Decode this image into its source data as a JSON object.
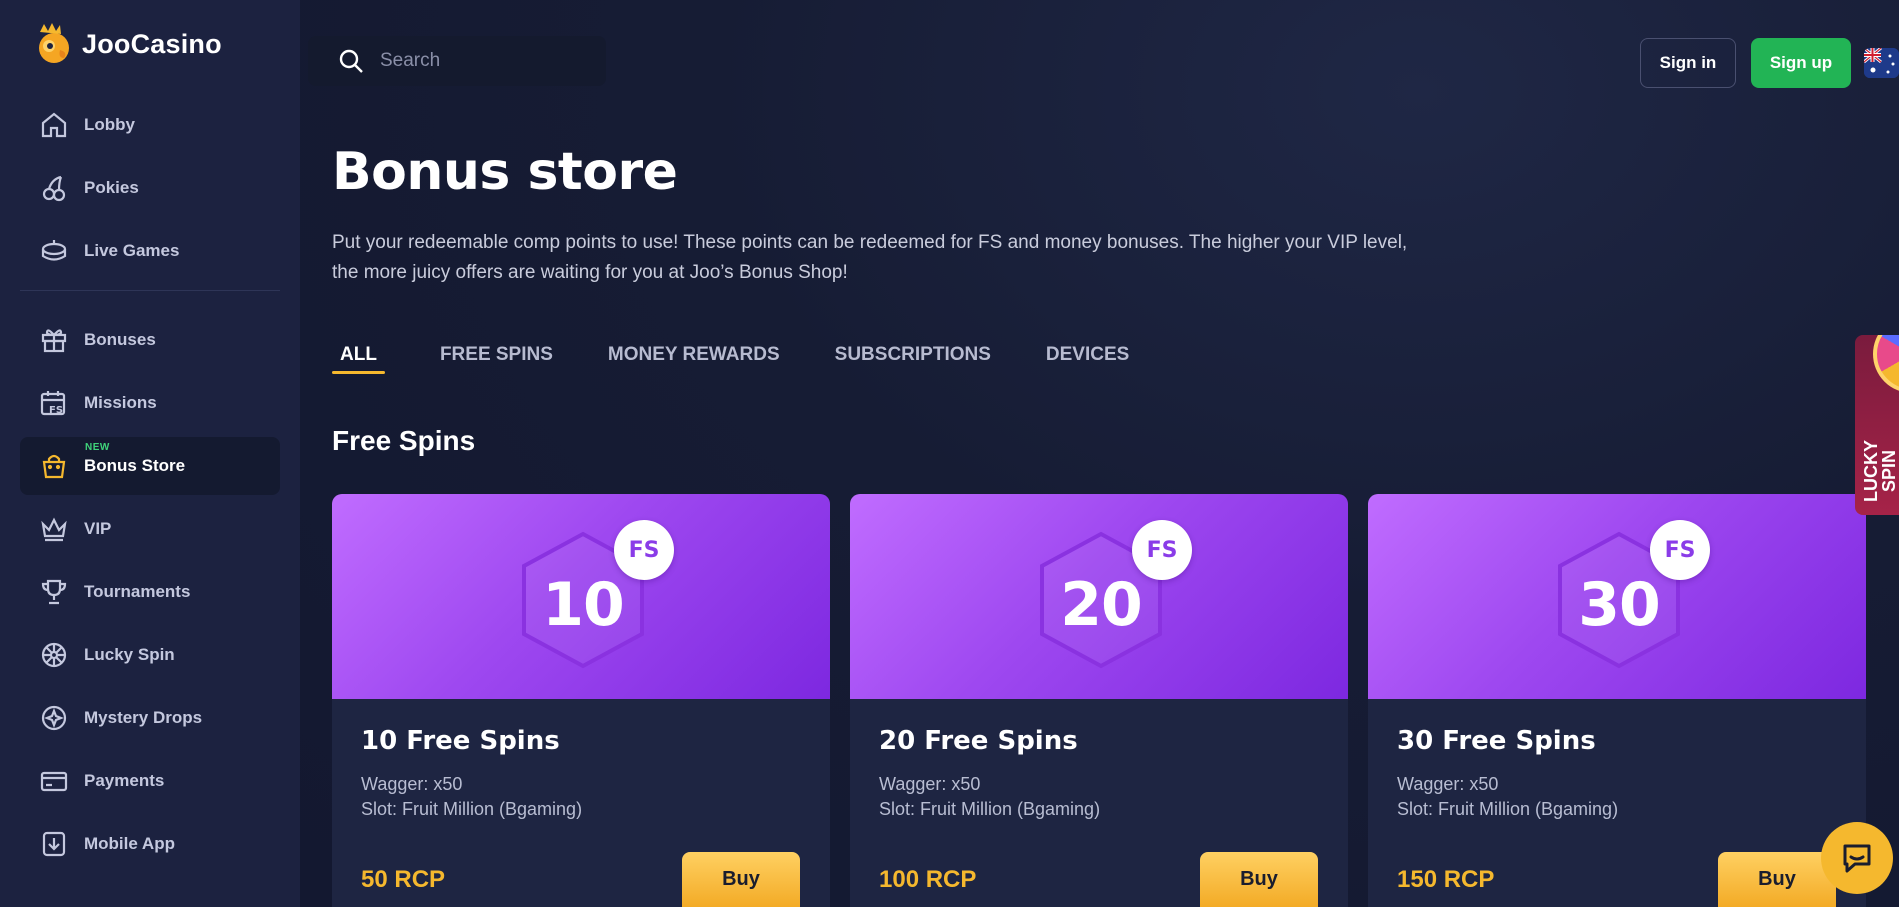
{
  "brand": {
    "name": "JooCasino"
  },
  "sidebar": {
    "items": [
      {
        "label": "Lobby",
        "icon": "home-icon"
      },
      {
        "label": "Pokies",
        "icon": "cherries-icon"
      },
      {
        "label": "Live Games",
        "icon": "live-table-icon"
      }
    ],
    "items2": [
      {
        "label": "Bonuses",
        "icon": "gift-icon"
      },
      {
        "label": "Missions",
        "icon": "calendar-fs-icon"
      },
      {
        "label": "Bonus Store",
        "icon": "shopping-bag-icon",
        "badge": "NEW",
        "active": true
      },
      {
        "label": "VIP",
        "icon": "crown-icon"
      },
      {
        "label": "Tournaments",
        "icon": "trophy-icon"
      },
      {
        "label": "Lucky Spin",
        "icon": "wheel-icon"
      },
      {
        "label": "Mystery Drops",
        "icon": "mystery-drop-icon"
      },
      {
        "label": "Payments",
        "icon": "card-icon"
      },
      {
        "label": "Mobile App",
        "icon": "download-icon"
      }
    ]
  },
  "header": {
    "search_placeholder": "Search",
    "signin_label": "Sign in",
    "signup_label": "Sign up",
    "flag": "australia-flag-icon"
  },
  "main": {
    "title": "Bonus store",
    "description": "Put your redeemable comp points to use! These points can be redeemed for FS and money bonuses. The higher your VIP level, the more juicy offers are waiting for you at Joo’s Bonus Shop!",
    "tabs": [
      {
        "label": "ALL",
        "active": true
      },
      {
        "label": "FREE SPINS"
      },
      {
        "label": "MONEY REWARDS"
      },
      {
        "label": "SUBSCRIPTIONS"
      },
      {
        "label": "DEVICES"
      }
    ],
    "section_title": "Free Spins",
    "cards": [
      {
        "badge": "FS",
        "number": "10",
        "title": "10 Free Spins",
        "wager": "Wagger: x50",
        "slot": "Slot: Fruit Million (Bgaming)",
        "price": "50 RCP",
        "buy_label": "Buy"
      },
      {
        "badge": "FS",
        "number": "20",
        "title": "20 Free Spins",
        "wager": "Wagger: x50",
        "slot": "Slot: Fruit Million (Bgaming)",
        "price": "100 RCP",
        "buy_label": "Buy"
      },
      {
        "badge": "FS",
        "number": "30",
        "title": "30 Free Spins",
        "wager": "Wagger: x50",
        "slot": "Slot: Fruit Million (Bgaming)",
        "price": "150 RCP",
        "buy_label": "Buy"
      }
    ]
  },
  "lucky_spin_tab": {
    "label_line1": "LUCKY",
    "label_line2": "SPIN"
  },
  "colors": {
    "accent_gold": "#f5b82e",
    "signup_green": "#22b455",
    "card_purple": "#9e48f0",
    "sidebar_bg": "#1c2240"
  }
}
